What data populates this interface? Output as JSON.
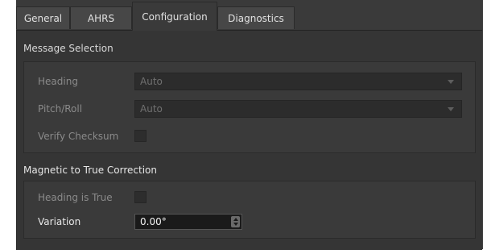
{
  "tabs": [
    "General",
    "AHRS",
    "Configuration",
    "Diagnostics"
  ],
  "message_selection": {
    "title": "Message Selection",
    "heading_label": "Heading",
    "heading_value": "Auto",
    "pitch_roll_label": "Pitch/Roll",
    "pitch_roll_value": "Auto",
    "verify_checksum_label": "Verify Checksum"
  },
  "magnetic": {
    "title": "Magnetic to True Correction",
    "heading_is_true_label": "Heading is True",
    "variation_label": "Variation",
    "variation_value": "0.00°"
  }
}
